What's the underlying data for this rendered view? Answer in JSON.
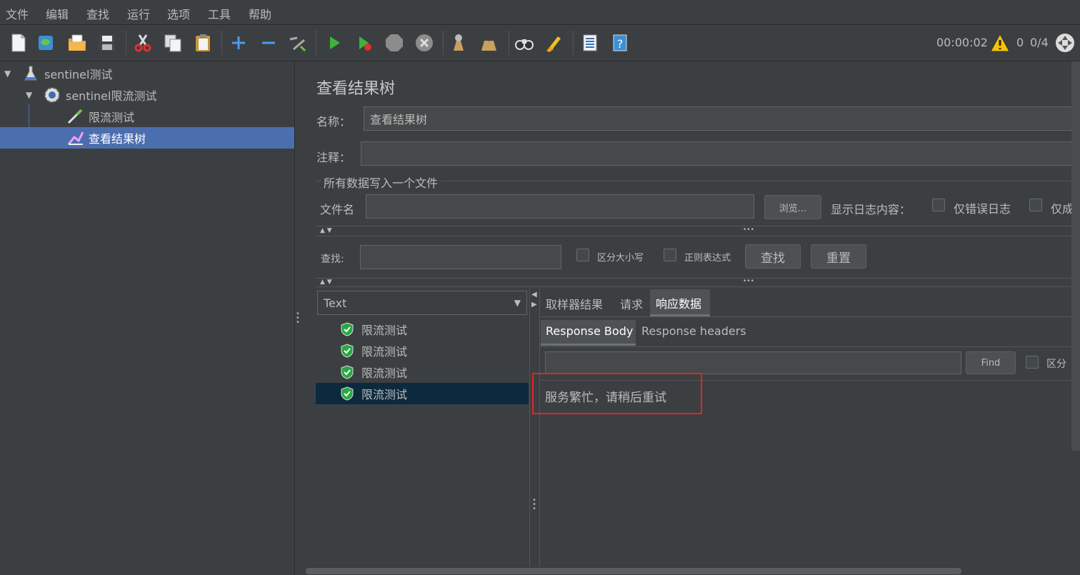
{
  "menu": [
    "文件",
    "编辑",
    "查找",
    "运行",
    "选项",
    "工具",
    "帮助"
  ],
  "status": {
    "timer": "00:00:02",
    "warnings": "0",
    "threads": "0/4"
  },
  "tree": {
    "root": "sentinel测试",
    "group": "sentinel限流测试",
    "sampler": "限流测试",
    "listener": "查看结果树"
  },
  "panel": {
    "title": "查看结果树",
    "name_label": "名称：",
    "name_value": "查看结果树",
    "comment_label": "注释：",
    "comment_value": "",
    "file_group": "所有数据写入一个文件",
    "file_label": "文件名",
    "file_value": "",
    "browse": "浏览...",
    "log_label": "显示日志内容：",
    "errors_only": "仅错误日志",
    "success_only": "仅成"
  },
  "search": {
    "label": "查找:",
    "value": "",
    "case": "区分大小写",
    "regex": "正则表达式",
    "find": "查找",
    "reset": "重置"
  },
  "results": {
    "renderer": "Text",
    "items": [
      "限流测试",
      "限流测试",
      "限流测试",
      "限流测试"
    ],
    "selected_index": 3
  },
  "tabs": {
    "sampler_result": "取样器结果",
    "request": "请求",
    "response": "响应数据"
  },
  "subtabs": {
    "body": "Response Body",
    "headers": "Response headers"
  },
  "response": {
    "find": "Find",
    "case": "区分",
    "search_value": "",
    "text": "服务繁忙，请稍后重试"
  },
  "colors": {
    "background": "#3c3f41",
    "selection": "#4b6eaf",
    "result_selection": "#0d293e",
    "highlight": "#e0242c"
  }
}
